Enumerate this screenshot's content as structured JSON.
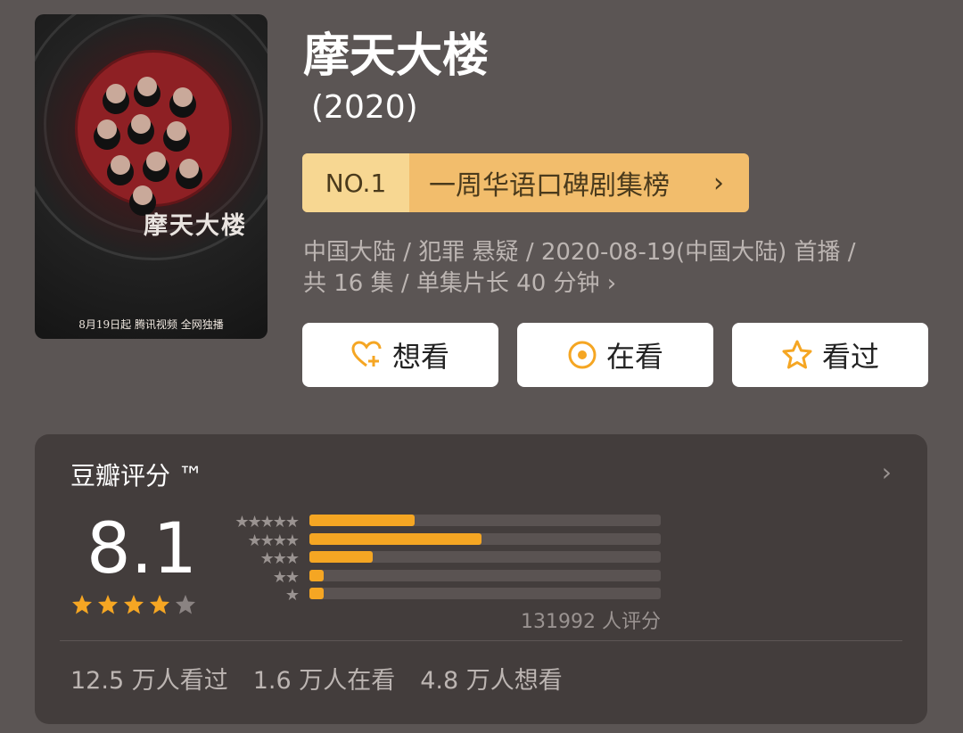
{
  "poster": {
    "title_art": "摩天大楼",
    "bottom_text": "8月19日起 腾讯视频 全网独播"
  },
  "show": {
    "title": "摩天大楼",
    "year": "(2020)"
  },
  "rank": {
    "number": "NO.1",
    "label": "一周华语口碑剧集榜",
    "chevron": "›"
  },
  "meta": {
    "line1": "中国大陆 / 犯罪 悬疑 / 2020-08-19(中国大陆) 首播 /",
    "line2": "共 16 集 / 单集片长 40 分钟",
    "chevron": "›"
  },
  "actions": [
    {
      "label": "想看",
      "icon": "heart-plus-icon"
    },
    {
      "label": "在看",
      "icon": "target-icon"
    },
    {
      "label": "看过",
      "icon": "star-outline-icon"
    }
  ],
  "rating": {
    "title": "豆瓣评分 ™",
    "chevron": "›",
    "score": "8.1",
    "stars": 4,
    "star_total": 5,
    "distribution": [
      {
        "stars": 5,
        "fraction": 0.3
      },
      {
        "stars": 4,
        "fraction": 0.49
      },
      {
        "stars": 3,
        "fraction": 0.18
      },
      {
        "stars": 2,
        "fraction": 0.04
      },
      {
        "stars": 1,
        "fraction": 0.04
      }
    ],
    "count": "131992 人评分",
    "accent": "#f5a623"
  },
  "stats": {
    "watched": "12.5 万人看过",
    "watching": "1.6 万人在看",
    "want": "4.8 万人想看"
  }
}
